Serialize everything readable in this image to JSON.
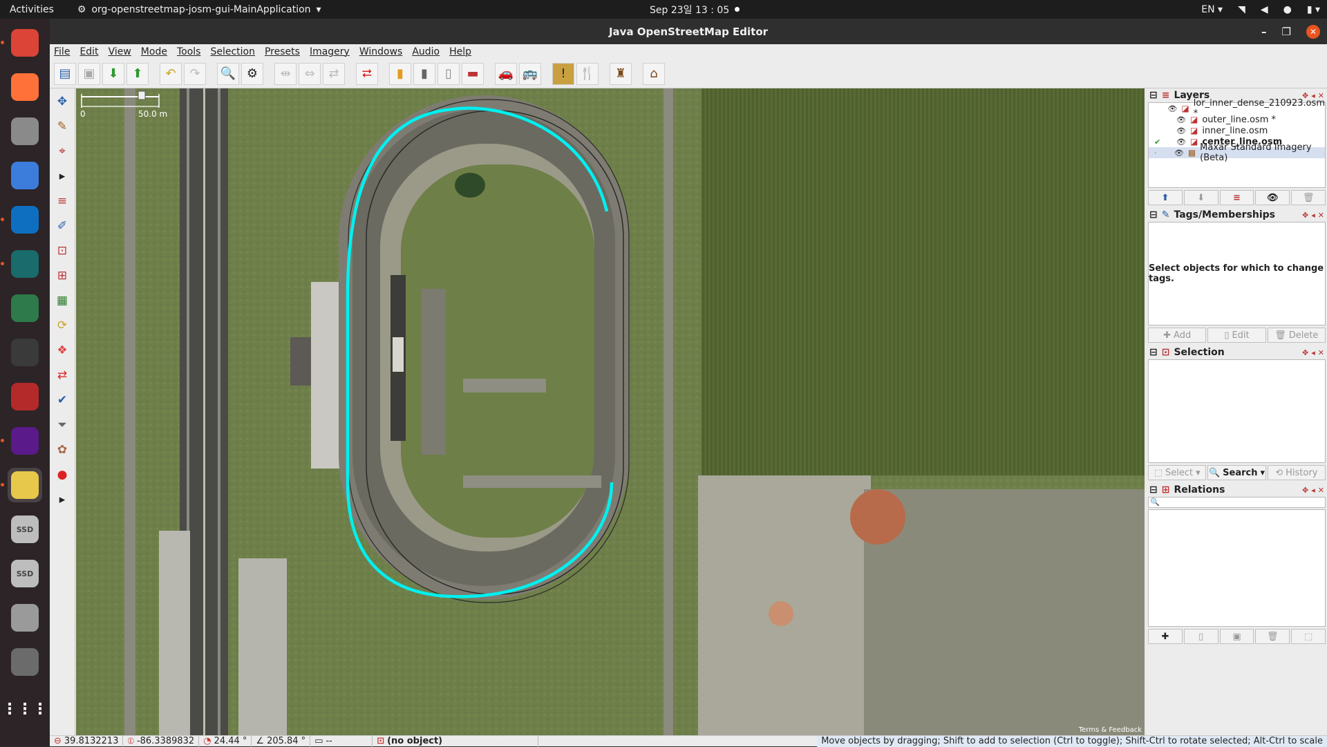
{
  "topbar": {
    "activities": "Activities",
    "app_menu": "org-openstreetmap-josm-gui-MainApplication",
    "clock": "Sep 23일  13 : 05",
    "lang": "EN"
  },
  "dock": {
    "items": [
      {
        "name": "chrome",
        "color": "#db4437",
        "running": true
      },
      {
        "name": "firefox",
        "color": "#ff7139",
        "running": false
      },
      {
        "name": "files",
        "color": "#8a8a8a",
        "running": false
      },
      {
        "name": "screenshot",
        "color": "#3c7ddc",
        "running": false
      },
      {
        "name": "vscode",
        "color": "#0e6fc1",
        "running": true
      },
      {
        "name": "gitkraken",
        "color": "#1a6b6b",
        "running": true
      },
      {
        "name": "camera-app",
        "color": "#2e7a4a",
        "running": false
      },
      {
        "name": "system-monitor",
        "color": "#3a3a3a",
        "running": false
      },
      {
        "name": "calendar-app",
        "color": "#b42a2a",
        "running": false
      },
      {
        "name": "plotjuggler",
        "color": "#5a1a8a",
        "running": true
      },
      {
        "name": "josm",
        "color": "#e8c84a",
        "running": true
      },
      {
        "name": "ssd-drive-1",
        "color": "#bdbdbd",
        "label": "SSD",
        "running": false
      },
      {
        "name": "ssd-drive-2",
        "color": "#bdbdbd",
        "label": "SSD",
        "running": false
      },
      {
        "name": "usb-drive",
        "color": "#9a9a9a",
        "running": false
      },
      {
        "name": "drive",
        "color": "#6b6b6b",
        "running": false
      }
    ]
  },
  "window": {
    "title": "Java OpenStreetMap Editor"
  },
  "menubar": [
    "File",
    "Edit",
    "View",
    "Mode",
    "Tools",
    "Selection",
    "Presets",
    "Imagery",
    "Windows",
    "Audio",
    "Help"
  ],
  "map": {
    "scale_label": "50.0 m",
    "scale_zero": "0",
    "attribution": "Terms & Feedback"
  },
  "layers_panel": {
    "title": "Layers",
    "layers": [
      {
        "name": "lor_inner_dense_210923.osm *",
        "active": false,
        "selected": false
      },
      {
        "name": "outer_line.osm *",
        "active": false,
        "selected": false
      },
      {
        "name": "inner_line.osm",
        "active": false,
        "selected": false
      },
      {
        "name": "center_line.osm",
        "active": true,
        "selected": false
      },
      {
        "name": "Maxar Standard Imagery (Beta)",
        "active": false,
        "selected": true
      }
    ]
  },
  "tags_panel": {
    "title": "Tags/Memberships",
    "empty_text": "Select objects for which to change tags.",
    "add": "Add",
    "edit": "Edit",
    "delete": "Delete"
  },
  "selection_panel": {
    "title": "Selection",
    "select": "Select",
    "search": "Search",
    "history": "History"
  },
  "relations_panel": {
    "title": "Relations"
  },
  "status": {
    "lat": "39.8132213",
    "lon": "-86.3389832",
    "heading": "24.44 °",
    "angle": "205.84 °",
    "dist": "--",
    "object": "(no object)",
    "help": "Move objects by dragging; Shift to add to selection (Ctrl to toggle); Shift-Ctrl to rotate selected; Alt-Ctrl to scale"
  },
  "colors": {
    "track_line": "#00f0f0",
    "accent": "#e95420"
  }
}
